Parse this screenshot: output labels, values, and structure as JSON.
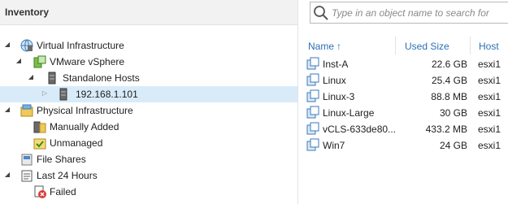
{
  "inventory": {
    "title": "Inventory",
    "tree": [
      {
        "label": "Virtual Infrastructure",
        "icon": "virtual-infrastructure-icon",
        "expanded": true
      },
      {
        "label": "VMware vSphere",
        "icon": "vmware-vsphere-icon",
        "expanded": true
      },
      {
        "label": "Standalone Hosts",
        "icon": "standalone-hosts-icon",
        "expanded": true
      },
      {
        "label": "192.168.1.101",
        "icon": "host-server-icon",
        "expanded": false,
        "selected": true
      },
      {
        "label": "Physical Infrastructure",
        "icon": "physical-infrastructure-icon",
        "expanded": true
      },
      {
        "label": "Manually Added",
        "icon": "manually-added-icon"
      },
      {
        "label": "Unmanaged",
        "icon": "unmanaged-icon"
      },
      {
        "label": "File Shares",
        "icon": "file-shares-icon"
      },
      {
        "label": "Last 24 Hours",
        "icon": "last-24-hours-icon",
        "expanded": true
      },
      {
        "label": "Failed",
        "icon": "failed-icon"
      }
    ]
  },
  "search": {
    "placeholder": "Type in an object name to search for"
  },
  "table": {
    "columns": {
      "name": "Name",
      "used_size": "Used Size",
      "host": "Host"
    },
    "sort_indicator": "↑",
    "rows": [
      {
        "name": "Inst-A",
        "used_size": "22.6 GB",
        "host": "esxi1"
      },
      {
        "name": "Linux",
        "used_size": "25.4 GB",
        "host": "esxi1"
      },
      {
        "name": "Linux-3",
        "used_size": "88.8 MB",
        "host": "esxi1"
      },
      {
        "name": "Linux-Large",
        "used_size": "30 GB",
        "host": "esxi1"
      },
      {
        "name": "vCLS-633de80...",
        "used_size": "433.2 MB",
        "host": "esxi1"
      },
      {
        "name": "Win7",
        "used_size": "24 GB",
        "host": "esxi1"
      }
    ]
  },
  "colors": {
    "selected_bg": "#d9ebf9",
    "header_bg": "#f2f2f2",
    "link_blue": "#2b70b5"
  }
}
